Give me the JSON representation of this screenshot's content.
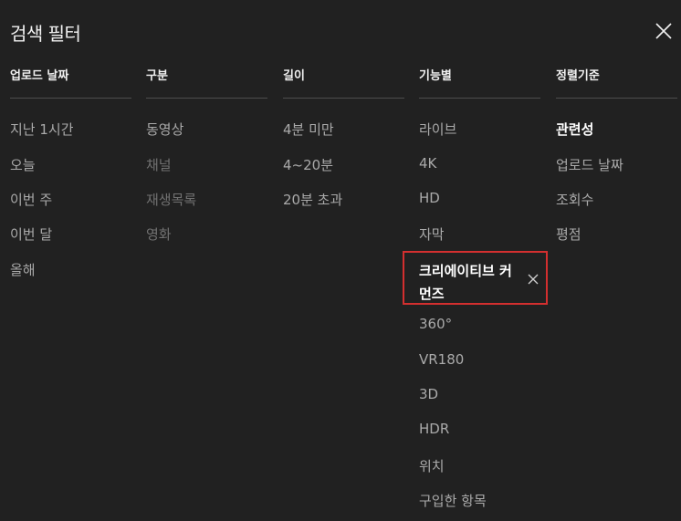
{
  "dialog": {
    "title": "검색 필터"
  },
  "columns": [
    {
      "header": "업로드 날짜",
      "options": [
        "지난 1시간",
        "오늘",
        "이번 주",
        "이번 달",
        "올해"
      ]
    },
    {
      "header": "구분",
      "options": [
        "동영상",
        "채널",
        "재생목록",
        "영화"
      ]
    },
    {
      "header": "길이",
      "options": [
        "4분 미만",
        "4~20분",
        "20분 초과"
      ]
    },
    {
      "header": "기능별",
      "options": [
        "라이브",
        "4K",
        "HD",
        "자막",
        "크리에이티브 커먼즈",
        "360°",
        "VR180",
        "3D",
        "HDR",
        "위치",
        "구입한 항목"
      ]
    },
    {
      "header": "정렬기준",
      "options": [
        "관련성",
        "업로드 날짜",
        "조회수",
        "평점"
      ]
    }
  ],
  "state": {
    "disabled_options": [
      "채널",
      "재생목록",
      "영화"
    ],
    "active_feature_filter": "크리에이티브 커먼즈",
    "selected_sort": "관련성"
  },
  "icons": {
    "close": "close-icon",
    "clear_filter": "close-icon"
  },
  "colors": {
    "background": "#212121",
    "text_primary": "#f1f1f1",
    "text_secondary": "#aaaaaa",
    "text_disabled": "#717171",
    "divider": "#4d4d4d",
    "highlight_border": "#d32f2f"
  }
}
